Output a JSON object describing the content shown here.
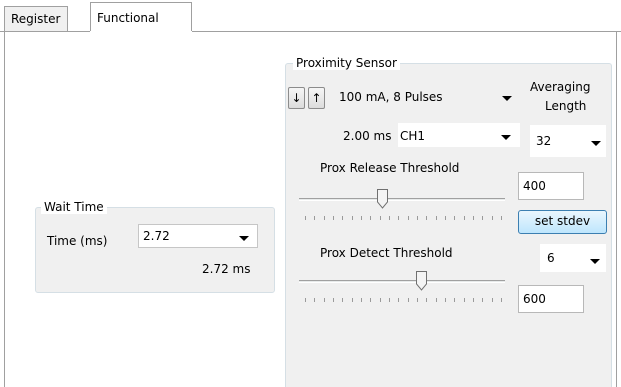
{
  "tabs": [
    {
      "label": "Register"
    },
    {
      "label": "Functional"
    }
  ],
  "wait_time": {
    "group_title": "Wait Time",
    "time_label": "Time (ms)",
    "time_value": "2.72",
    "time_readout": "2.72 ms"
  },
  "proximity": {
    "group_title": "Proximity Sensor",
    "down_arrow": "↓",
    "up_arrow": "↑",
    "pulse_value": "100 mA, 8 Pulses",
    "averaging_label_line1": "Averaging",
    "averaging_label_line2": "Length",
    "integration_readout": "2.00 ms",
    "channel_value": "CH1",
    "averaging_value": "32",
    "release_label": "Prox Release Threshold",
    "release_value": "400",
    "release_slider_fraction": 0.4,
    "set_stdev_label": "set stdev",
    "stdev_value": "6",
    "detect_label": "Prox Detect Threshold",
    "detect_value": "600",
    "detect_slider_fraction": 0.6
  }
}
